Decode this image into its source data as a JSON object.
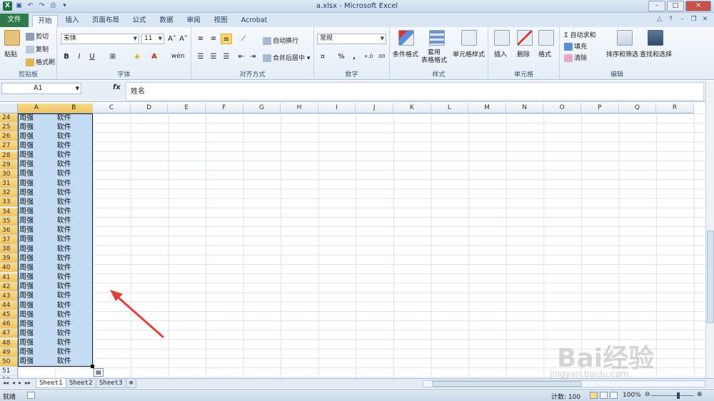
{
  "titlebar": {
    "title": "a.xlsx - Microsoft Excel"
  },
  "tabs": [
    "文件",
    "开始",
    "插入",
    "页面布局",
    "公式",
    "数据",
    "审阅",
    "视图",
    "Acrobat"
  ],
  "ribbon": {
    "clipboard": {
      "paste": "粘贴",
      "cut": "剪切",
      "copy": "复制",
      "format_painter": "格式刷",
      "label": "剪贴板"
    },
    "font": {
      "name": "宋体",
      "size": "11",
      "bold": "B",
      "italic": "I",
      "underline": "U",
      "phonetic": "wén",
      "label": "字体"
    },
    "alignment": {
      "wrap": "自动换行",
      "merge": "合并后居中",
      "label": "对齐方式"
    },
    "number": {
      "format": "常规",
      "percent": "%",
      "comma": ",",
      "label": "数字"
    },
    "styles": {
      "conditional": "条件格式",
      "table": "套用\n表格格式",
      "cell_styles": "单元格样式",
      "label": "样式"
    },
    "cells": {
      "insert": "插入",
      "delete": "删除",
      "format": "格式",
      "label": "单元格"
    },
    "editing": {
      "autosum": "Σ 自动求和",
      "fill": "填充",
      "clear": "清除",
      "sort": "排序和筛选",
      "find": "查找和选择",
      "label": "编辑"
    }
  },
  "formula_bar": {
    "name_box": "A1",
    "fx": "fx",
    "content": "姓名"
  },
  "columns": [
    "A",
    "B",
    "C",
    "D",
    "E",
    "F",
    "G",
    "H",
    "I",
    "J",
    "K",
    "L",
    "M",
    "N",
    "O",
    "P",
    "Q",
    "R"
  ],
  "rows": [
    {
      "n": "24",
      "a": "周强",
      "b": "软件"
    },
    {
      "n": "25",
      "a": "周强",
      "b": "软件"
    },
    {
      "n": "26",
      "a": "周强",
      "b": "软件"
    },
    {
      "n": "27",
      "a": "周强",
      "b": "软件"
    },
    {
      "n": "28",
      "a": "周强",
      "b": "软件"
    },
    {
      "n": "29",
      "a": "周强",
      "b": "软件"
    },
    {
      "n": "30",
      "a": "周强",
      "b": "软件"
    },
    {
      "n": "31",
      "a": "周强",
      "b": "软件"
    },
    {
      "n": "32",
      "a": "周强",
      "b": "软件"
    },
    {
      "n": "33",
      "a": "周强",
      "b": "软件"
    },
    {
      "n": "34",
      "a": "周强",
      "b": "软件"
    },
    {
      "n": "35",
      "a": "周强",
      "b": "软件"
    },
    {
      "n": "36",
      "a": "周强",
      "b": "软件"
    },
    {
      "n": "37",
      "a": "周强",
      "b": "软件"
    },
    {
      "n": "38",
      "a": "周强",
      "b": "软件"
    },
    {
      "n": "39",
      "a": "周强",
      "b": "软件"
    },
    {
      "n": "40",
      "a": "周强",
      "b": "软件"
    },
    {
      "n": "41",
      "a": "周强",
      "b": "软件"
    },
    {
      "n": "42",
      "a": "周强",
      "b": "软件"
    },
    {
      "n": "43",
      "a": "周强",
      "b": "软件"
    },
    {
      "n": "44",
      "a": "周强",
      "b": "软件"
    },
    {
      "n": "45",
      "a": "周强",
      "b": "软件"
    },
    {
      "n": "46",
      "a": "周强",
      "b": "软件"
    },
    {
      "n": "47",
      "a": "周强",
      "b": "软件"
    },
    {
      "n": "48",
      "a": "周强",
      "b": "软件"
    },
    {
      "n": "49",
      "a": "周强",
      "b": "软件"
    },
    {
      "n": "50",
      "a": "周强",
      "b": "软件"
    },
    {
      "n": "51",
      "a": "",
      "b": ""
    },
    {
      "n": "52",
      "a": "",
      "b": ""
    }
  ],
  "sheets": [
    "Sheet1",
    "Sheet2",
    "Sheet3"
  ],
  "status": {
    "ready": "就绪",
    "count": "计数: 100",
    "zoom": "100%"
  },
  "watermark": {
    "logo": "Bai经验",
    "url": "jingyan.baidu.com"
  },
  "colors": {
    "selection": "#c5dcf5",
    "header_selected": "#f1c15d",
    "arrow": "#e0403a",
    "file_tab": "#2f7a4a"
  }
}
